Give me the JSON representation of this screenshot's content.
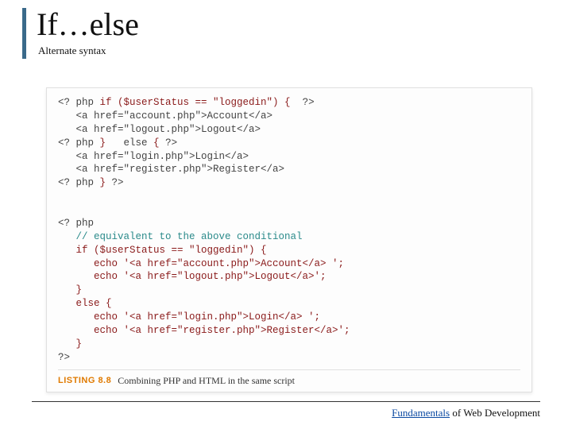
{
  "header": {
    "title": "If…else",
    "subtitle": "Alternate syntax"
  },
  "code": {
    "l1a": "<? php ",
    "l1b": "if ($userStatus == \"loggedin\") {",
    "l1c": "  ?>",
    "l2": "   <a href=\"account.php\">Account</a>",
    "l3": "   <a href=\"logout.php\">Logout</a>",
    "l4a": "<? php ",
    "l4b": "}",
    "l4c": "   else ",
    "l4d": "{",
    "l4e": " ?>",
    "l5": "   <a href=\"login.php\">Login</a>",
    "l6": "   <a href=\"register.php\">Register</a>",
    "l7a": "<? php ",
    "l7b": "}",
    "l7c": " ?>",
    "blank": "",
    "l8": "<? php",
    "l9": "   // equivalent to the above conditional",
    "l10": "   if ($userStatus == \"loggedin\") {",
    "l11": "      echo '<a href=\"account.php\">Account</a> ';",
    "l12": "      echo '<a href=\"logout.php\">Logout</a>';",
    "l13": "   }",
    "l14": "   else {",
    "l15": "      echo '<a href=\"login.php\">Login</a> ';",
    "l16": "      echo '<a href=\"register.php\">Register</a>';",
    "l17": "   }",
    "l18": "?>"
  },
  "caption": {
    "tag": "LISTING 8.8",
    "text": "Combining PHP and HTML in the same script"
  },
  "footer": {
    "link": "Fundamentals",
    "rest": " of Web Development"
  }
}
